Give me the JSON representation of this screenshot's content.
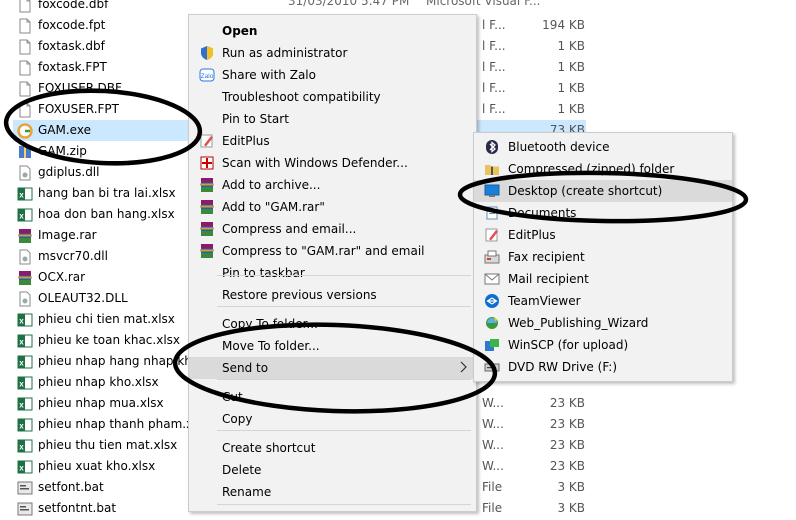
{
  "files": [
    {
      "name": "foxcode.dbf",
      "icon": "blank-file-icon",
      "type": "",
      "size": "",
      "date": "31/03/2010 5:47 PM",
      "type_top": "Microsoft Visual F..."
    },
    {
      "name": "foxcode.fpt",
      "icon": "blank-file-icon",
      "type": "l F...",
      "size": "194 KB"
    },
    {
      "name": "foxtask.dbf",
      "icon": "blank-file-icon",
      "type": "l F...",
      "size": "1 KB"
    },
    {
      "name": "foxtask.FPT",
      "icon": "blank-file-icon",
      "type": "l F...",
      "size": "1 KB"
    },
    {
      "name": "FOXUSER.DBF",
      "icon": "blank-file-icon",
      "type": "l F...",
      "size": "1 KB"
    },
    {
      "name": "FOXUSER.FPT",
      "icon": "blank-file-icon",
      "type": "l F...",
      "size": "1 KB"
    },
    {
      "name": "GAM.exe",
      "icon": "app-g-icon",
      "type": "",
      "size": "73 KB",
      "selected": true
    },
    {
      "name": "GAM.zip",
      "icon": "zip-icon",
      "type": "",
      "size": ""
    },
    {
      "name": "gdiplus.dll",
      "icon": "dll-icon",
      "type": "",
      "size": ""
    },
    {
      "name": "hang ban bi tra lai.xlsx",
      "icon": "excel-icon",
      "type": "",
      "size": ""
    },
    {
      "name": "hoa don ban hang.xlsx",
      "icon": "excel-icon",
      "type": "",
      "size": ""
    },
    {
      "name": "Image.rar",
      "icon": "rar-icon",
      "type": "",
      "size": ""
    },
    {
      "name": "msvcr70.dll",
      "icon": "dll-icon",
      "type": "",
      "size": ""
    },
    {
      "name": "OCX.rar",
      "icon": "rar-icon",
      "type": "",
      "size": ""
    },
    {
      "name": "OLEAUT32.DLL",
      "icon": "dll-icon",
      "type": "",
      "size": ""
    },
    {
      "name": "phieu chi tien mat.xlsx",
      "icon": "excel-icon",
      "type": "",
      "size": ""
    },
    {
      "name": "phieu ke toan khac.xlsx",
      "icon": "excel-icon",
      "type": "",
      "size": ""
    },
    {
      "name": "phieu nhap hang nhap kha",
      "icon": "excel-icon",
      "type": "",
      "size": ""
    },
    {
      "name": "phieu nhap kho.xlsx",
      "icon": "excel-icon",
      "type": "",
      "size": ""
    },
    {
      "name": "phieu nhap mua.xlsx",
      "icon": "excel-icon",
      "type": "W...",
      "size": "23 KB"
    },
    {
      "name": "phieu nhap thanh pham.xlsx",
      "icon": "excel-icon",
      "type": "W...",
      "size": "23 KB"
    },
    {
      "name": "phieu thu tien mat.xlsx",
      "icon": "excel-icon",
      "type": "W...",
      "size": "23 KB"
    },
    {
      "name": "phieu xuat kho.xlsx",
      "icon": "excel-icon",
      "type": "W...",
      "size": "23 KB"
    },
    {
      "name": "setfont.bat",
      "icon": "bat-icon",
      "type": "File",
      "size": "3 KB"
    },
    {
      "name": "setfontnt.bat",
      "icon": "bat-icon",
      "type": "File",
      "size": "3 KB"
    }
  ],
  "context_menu": {
    "items": [
      {
        "label": "Open",
        "icon": "",
        "bold": true
      },
      {
        "label": "Run as administrator",
        "icon": "shield-icon"
      },
      {
        "label": "Share with Zalo",
        "icon": "zalo-icon"
      },
      {
        "label": "Troubleshoot compatibility",
        "icon": ""
      },
      {
        "label": "Pin to Start",
        "icon": ""
      },
      {
        "label": "EditPlus",
        "icon": "editplus-icon"
      },
      {
        "label": "Scan with Windows Defender...",
        "icon": "defender-icon"
      },
      {
        "label": "Add to archive...",
        "icon": "winrar-icon"
      },
      {
        "label": "Add to \"GAM.rar\"",
        "icon": "winrar-icon"
      },
      {
        "label": "Compress and email...",
        "icon": "winrar-icon"
      },
      {
        "label": "Compress to \"GAM.rar\" and email",
        "icon": "winrar-icon"
      },
      {
        "label": "Pin to taskbar",
        "icon": ""
      },
      {
        "label": "Restore previous versions",
        "icon": ""
      },
      {
        "label": "Copy To folder...",
        "icon": ""
      },
      {
        "label": "Move To folder...",
        "icon": ""
      },
      {
        "label": "Send to",
        "icon": "",
        "submenu": true,
        "hover": true
      },
      {
        "label": "Cut",
        "icon": ""
      },
      {
        "label": "Copy",
        "icon": ""
      },
      {
        "label": "Create shortcut",
        "icon": ""
      },
      {
        "label": "Delete",
        "icon": ""
      },
      {
        "label": "Rename",
        "icon": ""
      }
    ]
  },
  "send_to_menu": {
    "items": [
      {
        "label": "Bluetooth device",
        "icon": "bluetooth-icon"
      },
      {
        "label": "Compressed (zipped) folder",
        "icon": "zip-folder-icon"
      },
      {
        "label": "Desktop (create shortcut)",
        "icon": "desktop-icon",
        "hover": true
      },
      {
        "label": "Documents",
        "icon": "documents-icon"
      },
      {
        "label": "EditPlus",
        "icon": "editplus-icon"
      },
      {
        "label": "Fax recipient",
        "icon": "fax-icon"
      },
      {
        "label": "Mail recipient",
        "icon": "mail-icon"
      },
      {
        "label": "TeamViewer",
        "icon": "teamviewer-icon"
      },
      {
        "label": "Web_Publishing_Wizard",
        "icon": "wizard-icon"
      },
      {
        "label": "WinSCP (for upload)",
        "icon": "winscp-icon"
      },
      {
        "label": "DVD RW Drive (F:)",
        "icon": "dvd-drive-icon"
      }
    ]
  },
  "colors": {
    "selection": "#cce8ff",
    "menu_bg": "#f2f2f2",
    "menu_hover": "#dadada",
    "annotation": "#000000"
  }
}
